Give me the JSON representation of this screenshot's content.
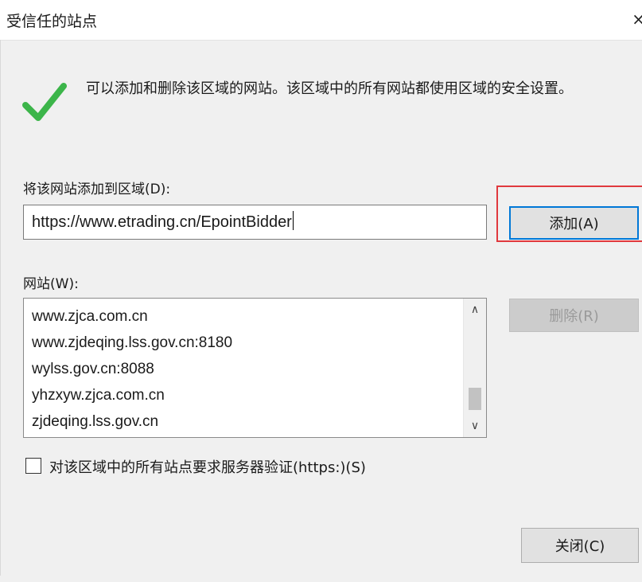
{
  "window": {
    "title": "受信任的站点",
    "close_glyph": "×"
  },
  "info": {
    "icon": "green-checkmark",
    "text": "可以添加和删除该区域的网站。该区域中的所有网站都使用区域的安全设置。"
  },
  "add_section": {
    "label": "将该网站添加到区域(D):",
    "url_value": "https://www.etrading.cn/EpointBidder",
    "add_button": "添加(A)"
  },
  "websites": {
    "label": "网站(W):",
    "items": [
      "www.zjca.com.cn",
      "www.zjdeqing.lss.gov.cn:8180",
      "wylss.gov.cn:8088",
      "yhzxyw.zjca.com.cn",
      "zjdeqing.lss.gov.cn"
    ],
    "remove_button": "删除(R)"
  },
  "require_https": {
    "label": "对该区域中的所有站点要求服务器验证(https:)(S)",
    "checked": false
  },
  "close_button": "关闭(C)",
  "colors": {
    "highlight_box": "#e0393e",
    "focus_border": "#0078d7",
    "check_green": "#3cb54a"
  }
}
